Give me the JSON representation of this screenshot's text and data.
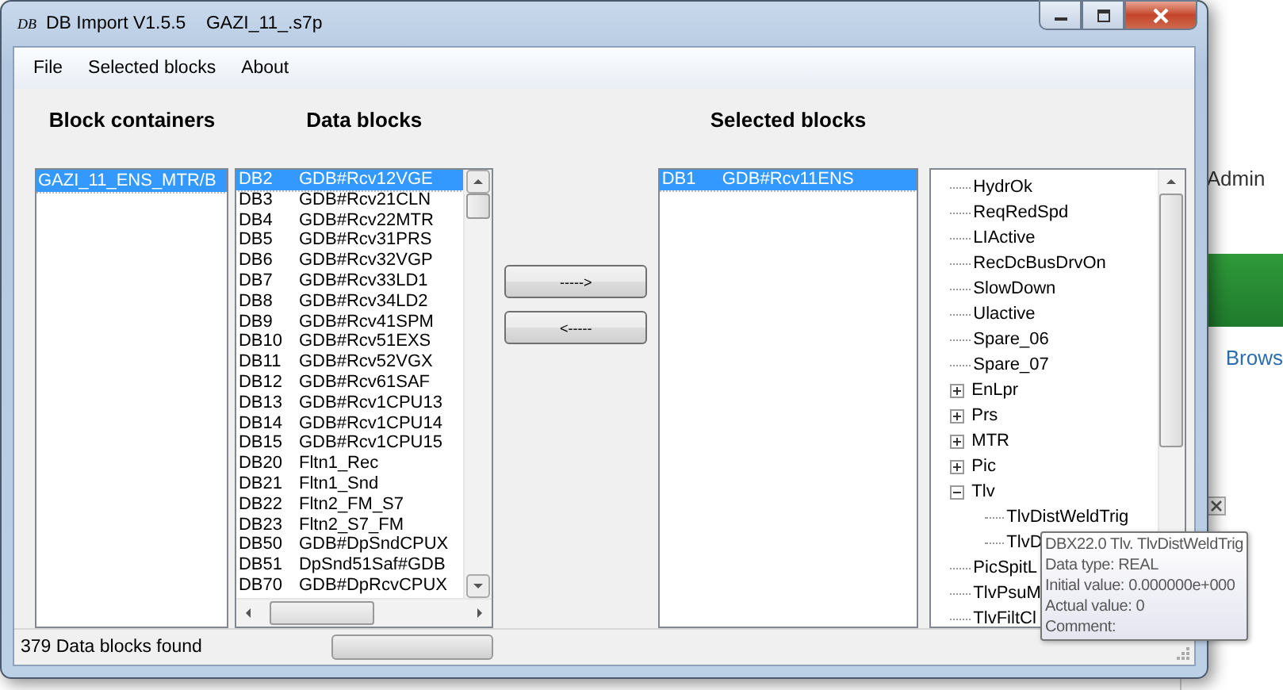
{
  "background_page": {
    "user_label": "Admin",
    "browse_link": "Brows"
  },
  "window": {
    "title": "DB Import V1.5.5    GAZI_11_.s7p",
    "icon_text": "DB"
  },
  "menu": [
    "File",
    "Selected blocks",
    "About"
  ],
  "block_containers": {
    "heading": "Block containers",
    "items": [
      {
        "label": "GAZI_11_ENS_MTR/B",
        "selected": true
      }
    ]
  },
  "data_blocks": {
    "heading": "Data blocks",
    "items": [
      {
        "code": "DB2",
        "name": "GDB#Rcv12VGE",
        "selected": true
      },
      {
        "code": "DB3",
        "name": "GDB#Rcv21CLN",
        "selected": false
      },
      {
        "code": "DB4",
        "name": "GDB#Rcv22MTR",
        "selected": false
      },
      {
        "code": "DB5",
        "name": "GDB#Rcv31PRS",
        "selected": false
      },
      {
        "code": "DB6",
        "name": "GDB#Rcv32VGP",
        "selected": false
      },
      {
        "code": "DB7",
        "name": "GDB#Rcv33LD1",
        "selected": false
      },
      {
        "code": "DB8",
        "name": "GDB#Rcv34LD2",
        "selected": false
      },
      {
        "code": "DB9",
        "name": "GDB#Rcv41SPM",
        "selected": false
      },
      {
        "code": "DB10",
        "name": "GDB#Rcv51EXS",
        "selected": false
      },
      {
        "code": "DB11",
        "name": "GDB#Rcv52VGX",
        "selected": false
      },
      {
        "code": "DB12",
        "name": "GDB#Rcv61SAF",
        "selected": false
      },
      {
        "code": "DB13",
        "name": "GDB#Rcv1CPU13",
        "selected": false
      },
      {
        "code": "DB14",
        "name": "GDB#Rcv1CPU14",
        "selected": false
      },
      {
        "code": "DB15",
        "name": "GDB#Rcv1CPU15",
        "selected": false
      },
      {
        "code": "DB20",
        "name": "Fltn1_Rec",
        "selected": false
      },
      {
        "code": "DB21",
        "name": "Fltn1_Snd",
        "selected": false
      },
      {
        "code": "DB22",
        "name": "Fltn2_FM_S7",
        "selected": false
      },
      {
        "code": "DB23",
        "name": "Fltn2_S7_FM",
        "selected": false
      },
      {
        "code": "DB50",
        "name": "GDB#DpSndCPUX",
        "selected": false
      },
      {
        "code": "DB51",
        "name": "DpSnd51Saf#GDB",
        "selected": false
      },
      {
        "code": "DB70",
        "name": "GDB#DpRcvCPUX",
        "selected": false
      }
    ]
  },
  "buttons": [
    "----->",
    "<-----"
  ],
  "selected_blocks": {
    "heading": "Selected blocks",
    "items": [
      {
        "code": "DB1",
        "name": "GDB#Rcv11ENS",
        "selected": true
      }
    ]
  },
  "tree": [
    {
      "label": "HydrOk"
    },
    {
      "label": "ReqRedSpd"
    },
    {
      "label": "LIActive"
    },
    {
      "label": "RecDcBusDrvOn"
    },
    {
      "label": "SlowDown"
    },
    {
      "label": "Ulactive"
    },
    {
      "label": "Spare_06"
    },
    {
      "label": "Spare_07"
    },
    {
      "label": "EnLpr",
      "expanded": false
    },
    {
      "label": "Prs",
      "expanded": false
    },
    {
      "label": "MTR",
      "expanded": false
    },
    {
      "label": "Pic",
      "expanded": false
    },
    {
      "label": "Tlv",
      "expanded": true,
      "children": [
        {
          "label": "TlvDistWeldTrig"
        },
        {
          "label": "TlvD"
        }
      ]
    },
    {
      "label": "PicSpitL"
    },
    {
      "label": "TlvPsuM"
    },
    {
      "label": "TlvFiltCl"
    }
  ],
  "tooltip": [
    "DBX22.0 Tlv. TlvDistWeldTrig",
    "Data type: REAL",
    "Initial value:  0.000000e+000",
    "Actual value: 0",
    "Comment:"
  ],
  "status_bar": {
    "text": "379 Data blocks found"
  }
}
